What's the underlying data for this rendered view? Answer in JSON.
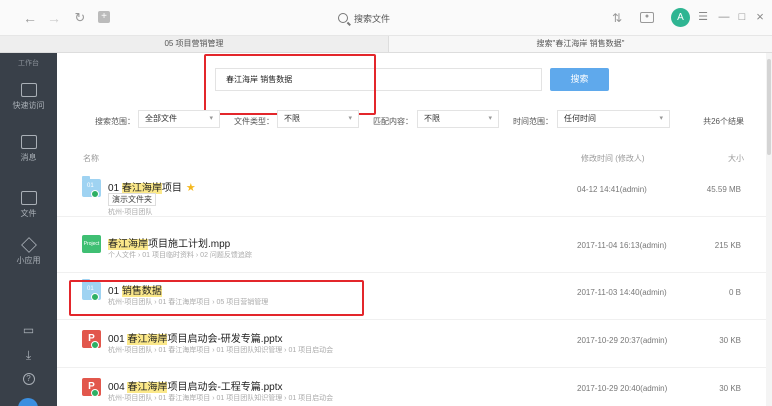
{
  "topbar": {
    "search_title": "搜索文件",
    "avatar_letter": "A"
  },
  "tabs": [
    {
      "label": "05 项目营销管理"
    },
    {
      "label": "搜索\"春江海岸 销售数据\""
    }
  ],
  "sidebar": {
    "header": "工作台",
    "items": [
      {
        "label": "快速访问"
      },
      {
        "label": "消息"
      },
      {
        "label": "文件"
      },
      {
        "label": "小应用"
      }
    ]
  },
  "search": {
    "query": "春江海岸 销售数据",
    "button_label": "搜索"
  },
  "filters": {
    "scope_label": "搜索范围：",
    "scope_value": "全部文件",
    "type_label": "文件类型：",
    "type_value": "不限",
    "match_label": "匹配内容：",
    "match_value": "不限",
    "time_label": "时间范围：",
    "time_value": "任何时间",
    "count": "共26个结果"
  },
  "columns": {
    "name": "名称",
    "modified": "修改时间 (修改人)",
    "size": "大小"
  },
  "rows": [
    {
      "num": "01",
      "title_pre": "01 ",
      "title_hl": "春江海岸",
      "title_post": "项目",
      "tag": "演示文件夹",
      "path": "杭州-项目团队",
      "time": "04-12 14:41(admin)",
      "size": "45.59 MB"
    },
    {
      "icon_text": "Project",
      "title_pre": "",
      "title_hl": "春江海岸",
      "title_post": "项目施工计划.mpp",
      "path": "个人文件 › 01 项目临时资料 › 02 问题反馈追踪",
      "time": "2017-11-04 16:13(admin)",
      "size": "215 KB"
    },
    {
      "num": "01",
      "title_pre": "01 ",
      "title_hl": "销售数据",
      "title_post": "",
      "path": "杭州-项目团队 › 01 春江海岸项目 › 05 项目营销管理",
      "time": "2017-11-03 14:40(admin)",
      "size": "0 B"
    },
    {
      "icon_text": "P",
      "title_pre": "001 ",
      "title_hl": "春江海岸",
      "title_post": "项目启动会-研发专篇.pptx",
      "path": "杭州-项目团队 › 01 春江海岸项目 › 01 项目团队知识管理 › 01 项目启动会",
      "time": "2017-10-29 20:37(admin)",
      "size": "30 KB"
    },
    {
      "icon_text": "P",
      "title_pre": "004 ",
      "title_hl": "春江海岸",
      "title_post": "项目启动会-工程专篇.pptx",
      "path": "杭州-项目团队 › 01 春江海岸项目 › 01 项目团队知识管理 › 01 项目启动会",
      "time": "2017-10-29 20:40(admin)",
      "size": "30 KB"
    }
  ]
}
